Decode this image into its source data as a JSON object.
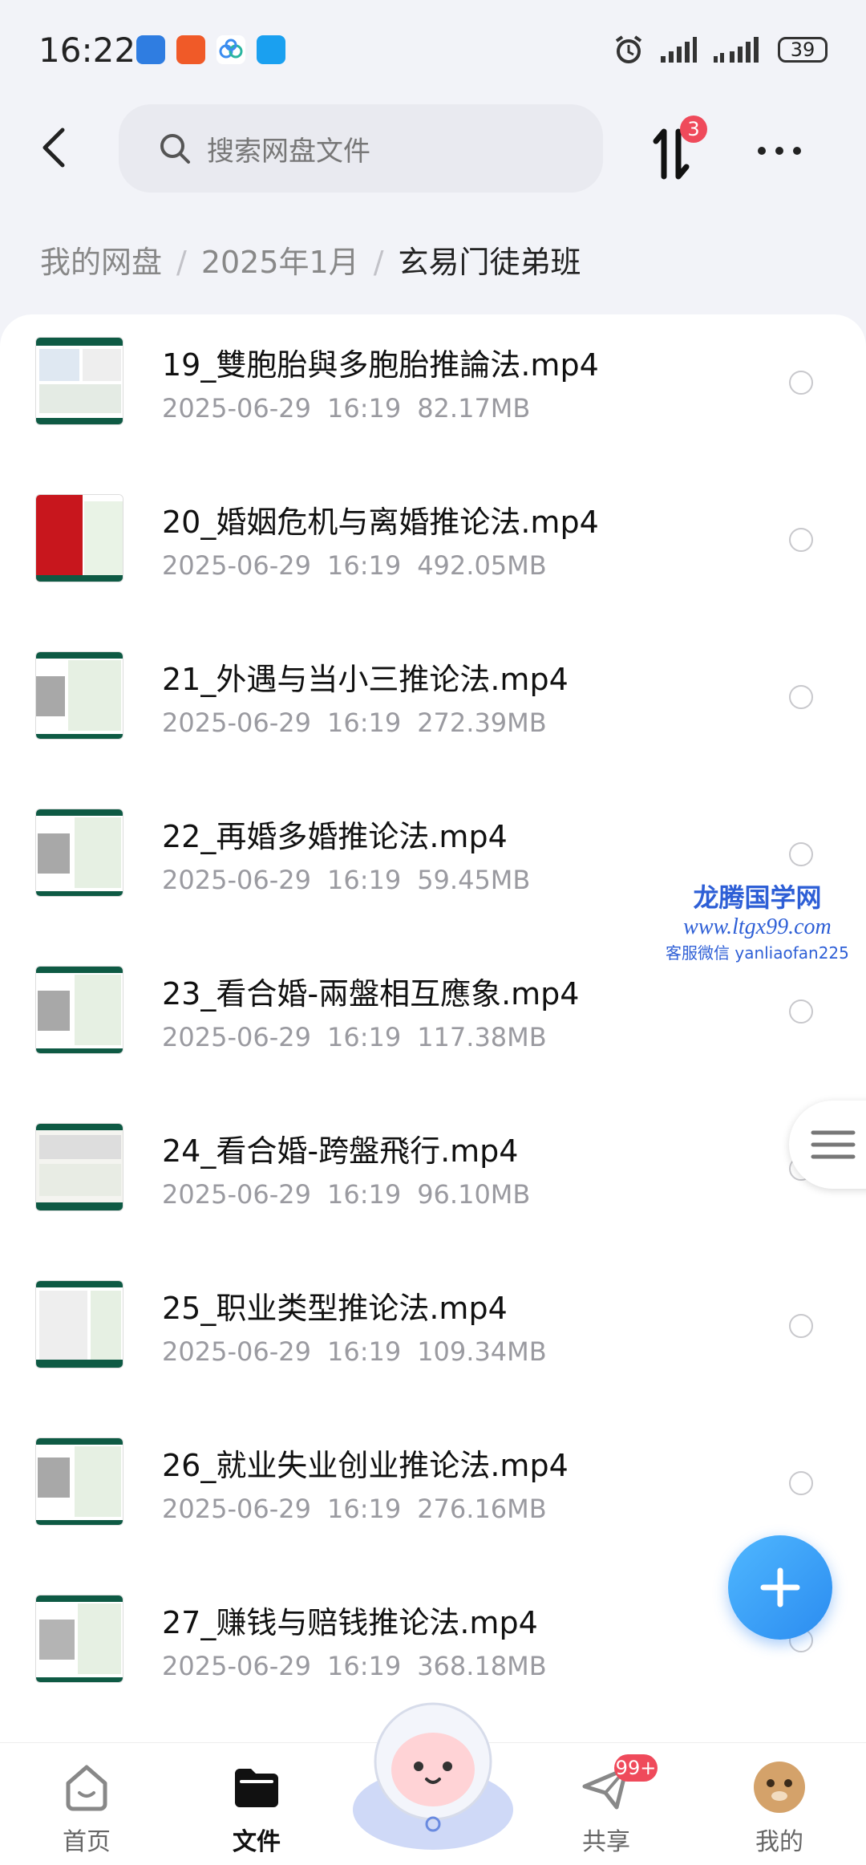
{
  "status_bar": {
    "time": "16:22",
    "battery": "39"
  },
  "search": {
    "placeholder": "搜索网盘文件"
  },
  "transfer_badge": "3",
  "breadcrumb": {
    "root": "我的网盘",
    "level1": "2025年1月",
    "current": "玄易门徒弟班"
  },
  "files": [
    {
      "name": "19_雙胞胎與多胞胎推論法.mp4",
      "date": "2025-06-29",
      "time": "16:19",
      "size": "82.17MB"
    },
    {
      "name": "20_婚姻危机与离婚推论法.mp4",
      "date": "2025-06-29",
      "time": "16:19",
      "size": "492.05MB"
    },
    {
      "name": "21_外遇与当小三推论法.mp4",
      "date": "2025-06-29",
      "time": "16:19",
      "size": "272.39MB"
    },
    {
      "name": "22_再婚多婚推论法.mp4",
      "date": "2025-06-29",
      "time": "16:19",
      "size": "59.45MB"
    },
    {
      "name": "23_看合婚-兩盤相互應象.mp4",
      "date": "2025-06-29",
      "time": "16:19",
      "size": "117.38MB"
    },
    {
      "name": "24_看合婚-跨盤飛行.mp4",
      "date": "2025-06-29",
      "time": "16:19",
      "size": "96.10MB"
    },
    {
      "name": "25_职业类型推论法.mp4",
      "date": "2025-06-29",
      "time": "16:19",
      "size": "109.34MB"
    },
    {
      "name": "26_就业失业创业推论法.mp4",
      "date": "2025-06-29",
      "time": "16:19",
      "size": "276.16MB"
    },
    {
      "name": "27_赚钱与赔钱推论法.mp4",
      "date": "2025-06-29",
      "time": "16:19",
      "size": "368.18MB"
    }
  ],
  "watermark": {
    "line1": "龙腾国学网",
    "line2": "www.ltgx99.com",
    "line3": "客服微信 yanliaofan225"
  },
  "bottom_nav": {
    "home": "首页",
    "files": "文件",
    "share": "共享",
    "share_badge": "99+",
    "me": "我的"
  }
}
